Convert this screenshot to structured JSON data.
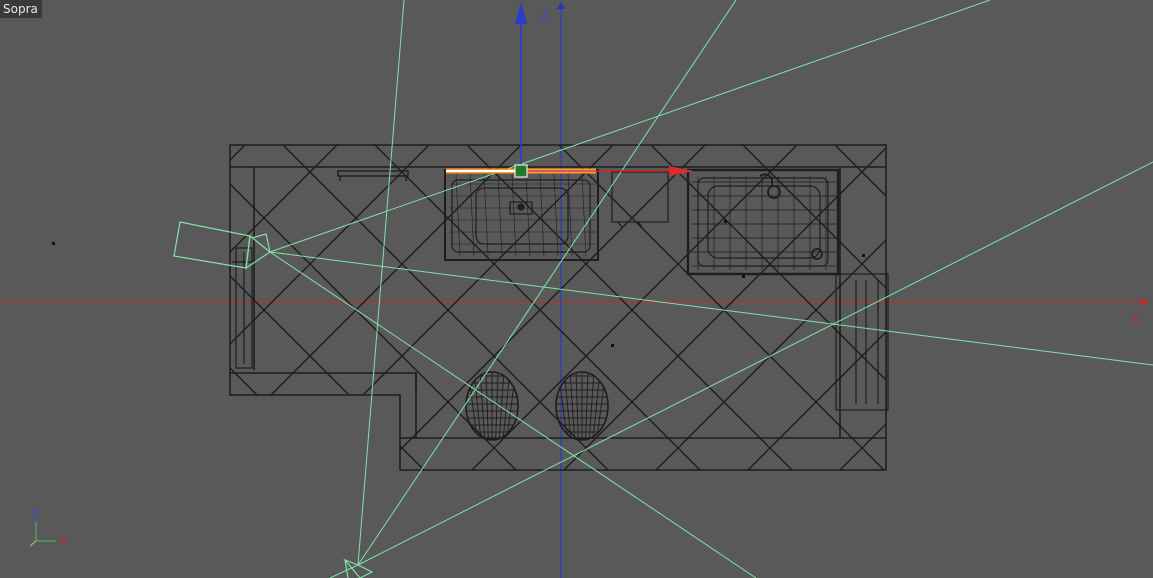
{
  "viewport": {
    "view_name": "Sopra",
    "axes": {
      "vertical": "Z",
      "horizontal": "X"
    },
    "gizmo": {
      "vertical": "Z",
      "horizontal": "X"
    }
  },
  "colors": {
    "background": "#595959",
    "wireframe": "#1e1e1e",
    "camera_frustum": "#7fe3a6",
    "x_axis": "#cc2222",
    "z_axis": "#2233cc",
    "gizmo_handle": "#1f7a2a",
    "selection_highlight": "#ff9a2a"
  },
  "icons": [
    "camera-icon",
    "transform-gizmo-icon",
    "axis-gizmo-icon"
  ]
}
